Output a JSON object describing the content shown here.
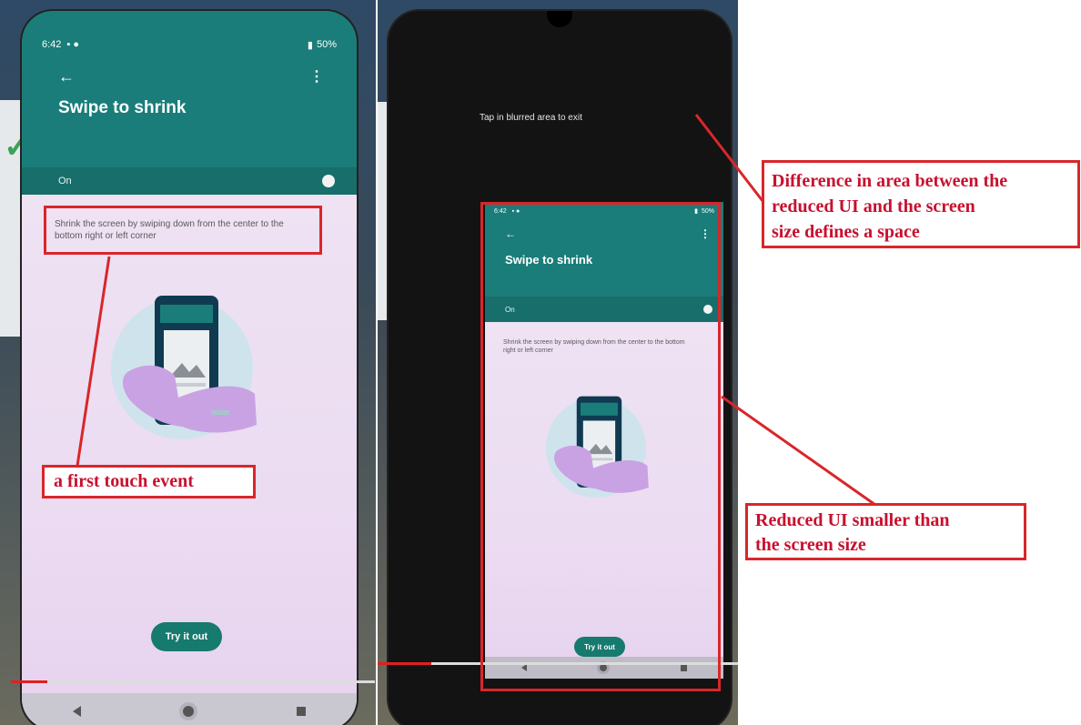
{
  "left": {
    "status": {
      "time": "6:42",
      "battery": "50%"
    },
    "header": {
      "title": "Swipe to shrink"
    },
    "toggle": {
      "label": "On"
    },
    "description": "Shrink the screen by swiping down from the center to the bottom right or left corner",
    "try_button": "Try it out",
    "video_progress": 0.1
  },
  "right": {
    "hint": "Tap in blurred area to exit",
    "status": {
      "time": "6:42",
      "battery": "50%"
    },
    "header": {
      "title": "Swipe to shrink"
    },
    "toggle": {
      "label": "On"
    },
    "description": "Shrink the screen by swiping down from the center to the bottom right or left corner",
    "try_button": "Try it out",
    "video_progress": 0.15
  },
  "annotations": {
    "first_touch": "a first touch event",
    "difference": [
      "Difference in area between the",
      "reduced UI and the screen",
      "size defines a space"
    ],
    "reduced": [
      "Reduced UI smaller than",
      "the screen size"
    ]
  },
  "colors": {
    "annotation_red": "#d9262b",
    "teal": "#1a7d7a",
    "content_bg": "#ecdcf2"
  },
  "icons": [
    "back-arrow-icon",
    "more-vert-icon",
    "battery-icon",
    "nav-back-icon",
    "nav-home-icon",
    "nav-recents-icon",
    "phone-hand-illustration"
  ]
}
